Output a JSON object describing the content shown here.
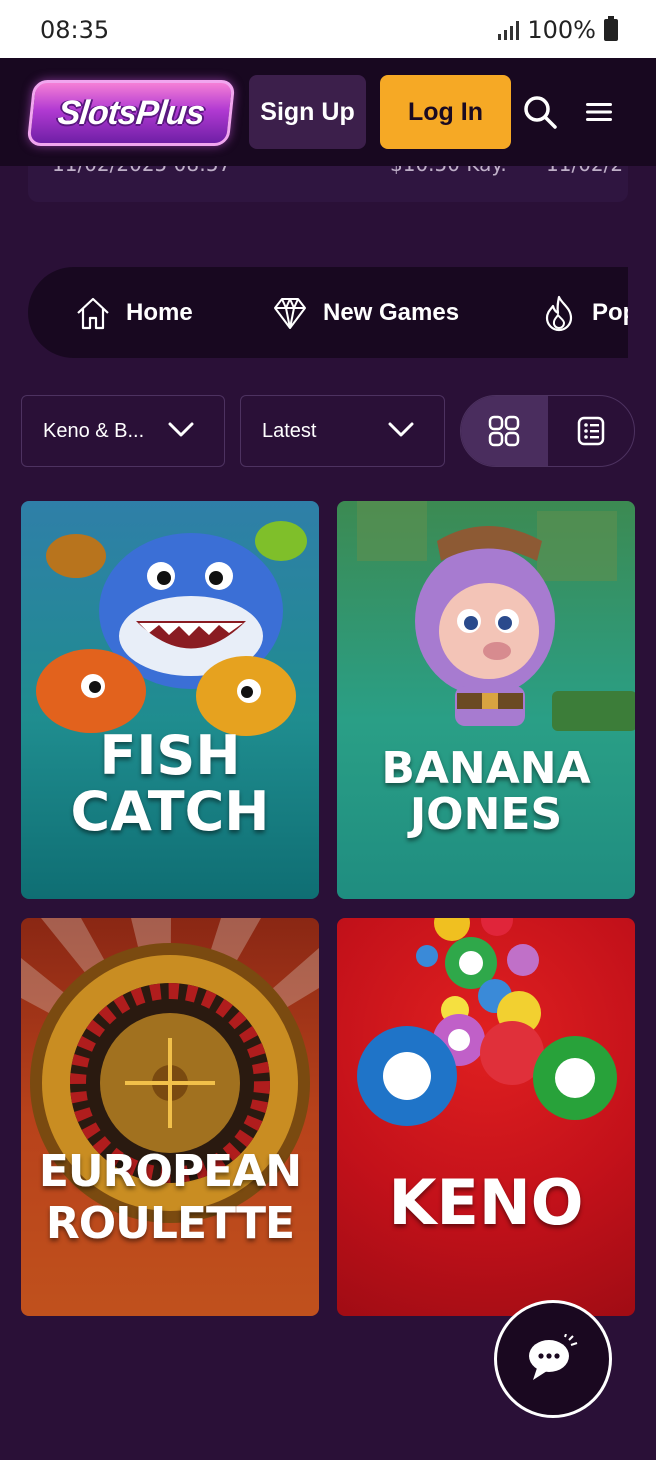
{
  "status_bar": {
    "time": "08:35",
    "battery": "100%"
  },
  "header": {
    "logo_text": "SlotsPlus",
    "signup_label": "Sign Up",
    "login_label": "Log In",
    "icons": {
      "search": "search-icon",
      "menu": "hamburger-menu-icon"
    }
  },
  "ticker": {
    "col1": "11/02/2025 08:57",
    "col2": "$10.50 Kay.",
    "col3": "11/02/2"
  },
  "nav": {
    "items": [
      {
        "label": "Home",
        "icon": "home-icon"
      },
      {
        "label": "New Games",
        "icon": "diamond-icon"
      },
      {
        "label": "Pop",
        "icon": "flame-icon"
      }
    ]
  },
  "filters": {
    "category": "Keno & B...",
    "sort": "Latest",
    "view_modes": [
      "grid-view-icon",
      "list-view-icon"
    ],
    "active_view": "grid"
  },
  "games": [
    {
      "title_line1": "FISH",
      "title_line2": "CATCH"
    },
    {
      "title_line1": "BANANA",
      "title_line2": "JONES"
    },
    {
      "title_line1": "EUROPEAN",
      "title_line2": "ROULETTE"
    },
    {
      "title_line1": "KENO",
      "title_line2": ""
    }
  ],
  "colors": {
    "background": "#2a1037",
    "header_bg": "#180820",
    "login_accent": "#f6a925",
    "logo_pink": "#e05ad0"
  },
  "chat": {
    "icon": "chat-bubble-icon"
  }
}
